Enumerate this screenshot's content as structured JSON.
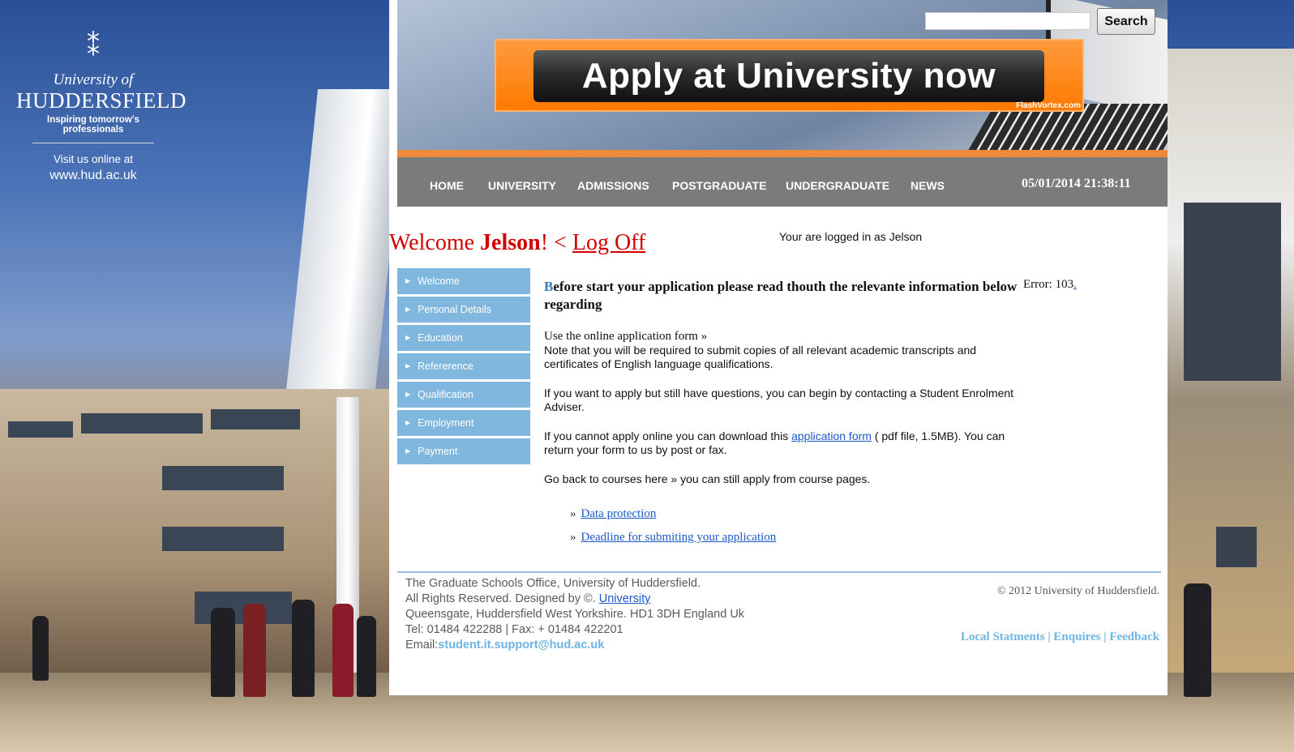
{
  "left_panel": {
    "logo_line1": "University of",
    "logo_line2": "HUDDERSFIELD",
    "tagline": "Inspiring tomorrow's professionals",
    "visit_text": "Visit us online at",
    "url": "www.hud.ac.uk"
  },
  "header": {
    "search_placeholder": "",
    "search_button": "Search",
    "banner_text": "Apply at University now",
    "banner_credit": "FlashVortex.com"
  },
  "nav": {
    "items": [
      "HOME",
      "UNIVERSITY",
      "ADMISSIONS",
      "POSTGRADUATE",
      "UNDERGRADUATE",
      "NEWS"
    ],
    "datetime": "05/01/2014 21:38:11"
  },
  "welcome": {
    "prefix": "Welcome ",
    "name": "Jelson",
    "separator": "! < ",
    "logoff": "Log Off",
    "logged_in_text": "Your are logged in as Jelson"
  },
  "side_menu": [
    "Welcome",
    "Personal Details",
    "Education",
    "Refererence",
    "Qualification",
    "Employment",
    "Payment"
  ],
  "content": {
    "heading_cap": "B",
    "heading_rest": "efore start your application please read thouth the relevante information below regarding",
    "form_line": "Use the online application form »",
    "note": "Note that you will be required to submit copies of all relevant academic transcripts and certificates of English language qualifications.",
    "questions": "If you want to apply but still have questions, you can begin by contacting a Student Enrolment Adviser.",
    "download_pre": "If you cannot apply online you can download this ",
    "download_link": "application form",
    "download_post": " ( pdf file, 1.5MB). You can return your form to us by post or fax.",
    "go_back": "Go back to courses here » you can still apply from course pages.",
    "links": [
      "Data protection",
      "Deadline for submiting your application"
    ]
  },
  "error": {
    "text": "Error: 103",
    "dot": "."
  },
  "footer": {
    "line1": "The Graduate Schools Office, University of Huddersfield.",
    "line2_pre": "All Rights Reserved. Designed by ©. ",
    "line2_link": "University",
    "line3": "Queensgate, Huddersfield West Yorkshire. HD1 3DH England Uk",
    "line4": "Tel: 01484 422288 | Fax: + 01484 422201",
    "email_label": "Email:",
    "email": "student.it.support@hud.ac.uk",
    "copyright": "© 2012 University of Huddersfield.",
    "links": [
      "Local Statments",
      "Enquires",
      "Feedback"
    ]
  }
}
